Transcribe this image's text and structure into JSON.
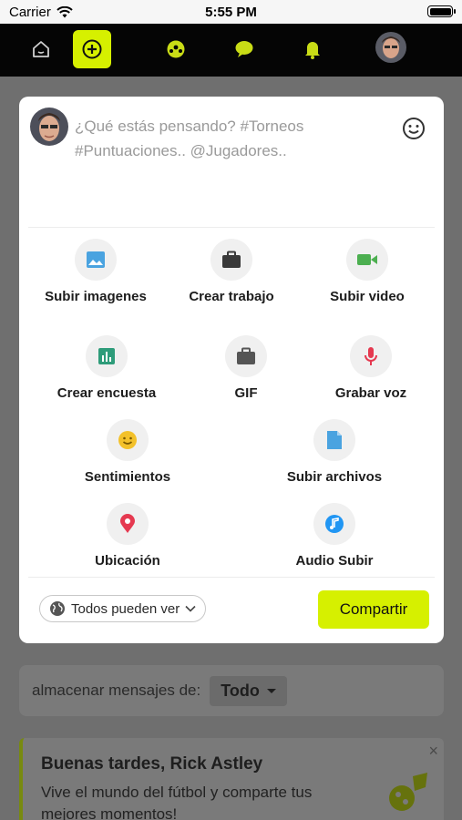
{
  "status_bar": {
    "carrier": "Carrier",
    "time": "5:55 PM"
  },
  "nav": {
    "items": [
      {
        "icon": "home-icon"
      },
      {
        "icon": "add-post-icon",
        "active": true
      },
      {
        "icon": "football-icon"
      },
      {
        "icon": "chat-icon"
      },
      {
        "icon": "bell-icon"
      },
      {
        "icon": "profile-avatar"
      }
    ],
    "accent_color": "#d6f000"
  },
  "composer": {
    "placeholder": "¿Qué estás pensando? #Torneos #Puntuaciones.. @Jugadores..",
    "actions": [
      {
        "label": "Subir imagenes",
        "icon": "image-icon",
        "color": "#4aa3e0"
      },
      {
        "label": "Crear trabajo",
        "icon": "briefcase-icon",
        "color": "#3a3a3a"
      },
      {
        "label": "Subir video",
        "icon": "video-icon",
        "color": "#4caf50"
      },
      {
        "label": "Crear encuesta",
        "icon": "poll-icon",
        "color": "#2e9c7a"
      },
      {
        "label": "GIF",
        "icon": "briefcase-icon",
        "color": "#555555"
      },
      {
        "label": "Grabar voz",
        "icon": "microphone-icon",
        "color": "#e53950"
      },
      {
        "label": "Sentimientos",
        "icon": "smiley-icon",
        "color": "#f3c12a"
      },
      {
        "label": "Subir archivos",
        "icon": "file-icon",
        "color": "#4aa3e0"
      },
      {
        "label": "Ubicación",
        "icon": "location-pin-icon",
        "color": "#e53950"
      },
      {
        "label": "Audio Subir",
        "icon": "music-note-icon",
        "color": "#2196f3"
      }
    ],
    "privacy_label": "Todos pueden ver",
    "share_label": "Compartir"
  },
  "feed_filter": {
    "label": "almacenar mensajes de:",
    "value": "Todo"
  },
  "welcome": {
    "title": "Buenas tardes, Rick Astley",
    "text": "Vive el mundo del fútbol y comparte tus mejores momentos!",
    "close": "×"
  }
}
